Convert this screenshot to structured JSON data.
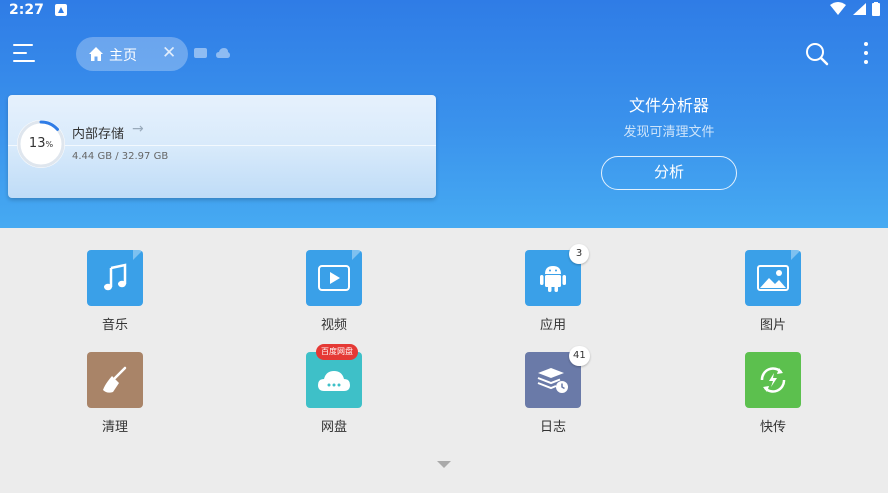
{
  "status_bar": {
    "time": "2:27"
  },
  "tabs": {
    "home_label": "主页"
  },
  "storage": {
    "title": "内部存储",
    "percent": "13",
    "percent_unit": "%",
    "size": "4.44 GB / 32.97 GB"
  },
  "analyzer": {
    "title": "文件分析器",
    "subtitle": "发现可清理文件",
    "button_label": "分析"
  },
  "grid": {
    "music": {
      "label": "音乐",
      "color": "#3aa0e8"
    },
    "video": {
      "label": "视频",
      "color": "#3aa0e8"
    },
    "apps": {
      "label": "应用",
      "badge": "3",
      "color": "#3aa0e8"
    },
    "pictures": {
      "label": "图片",
      "color": "#3aa0e8"
    },
    "cleaner": {
      "label": "清理",
      "color": "#a98468"
    },
    "netdisk": {
      "label": "网盘",
      "tag": "百度网盘",
      "color": "#3ec0c8"
    },
    "logs": {
      "label": "日志",
      "badge": "41",
      "color": "#6a7aa8"
    },
    "transfer": {
      "label": "快传",
      "color": "#5cc04e"
    }
  }
}
